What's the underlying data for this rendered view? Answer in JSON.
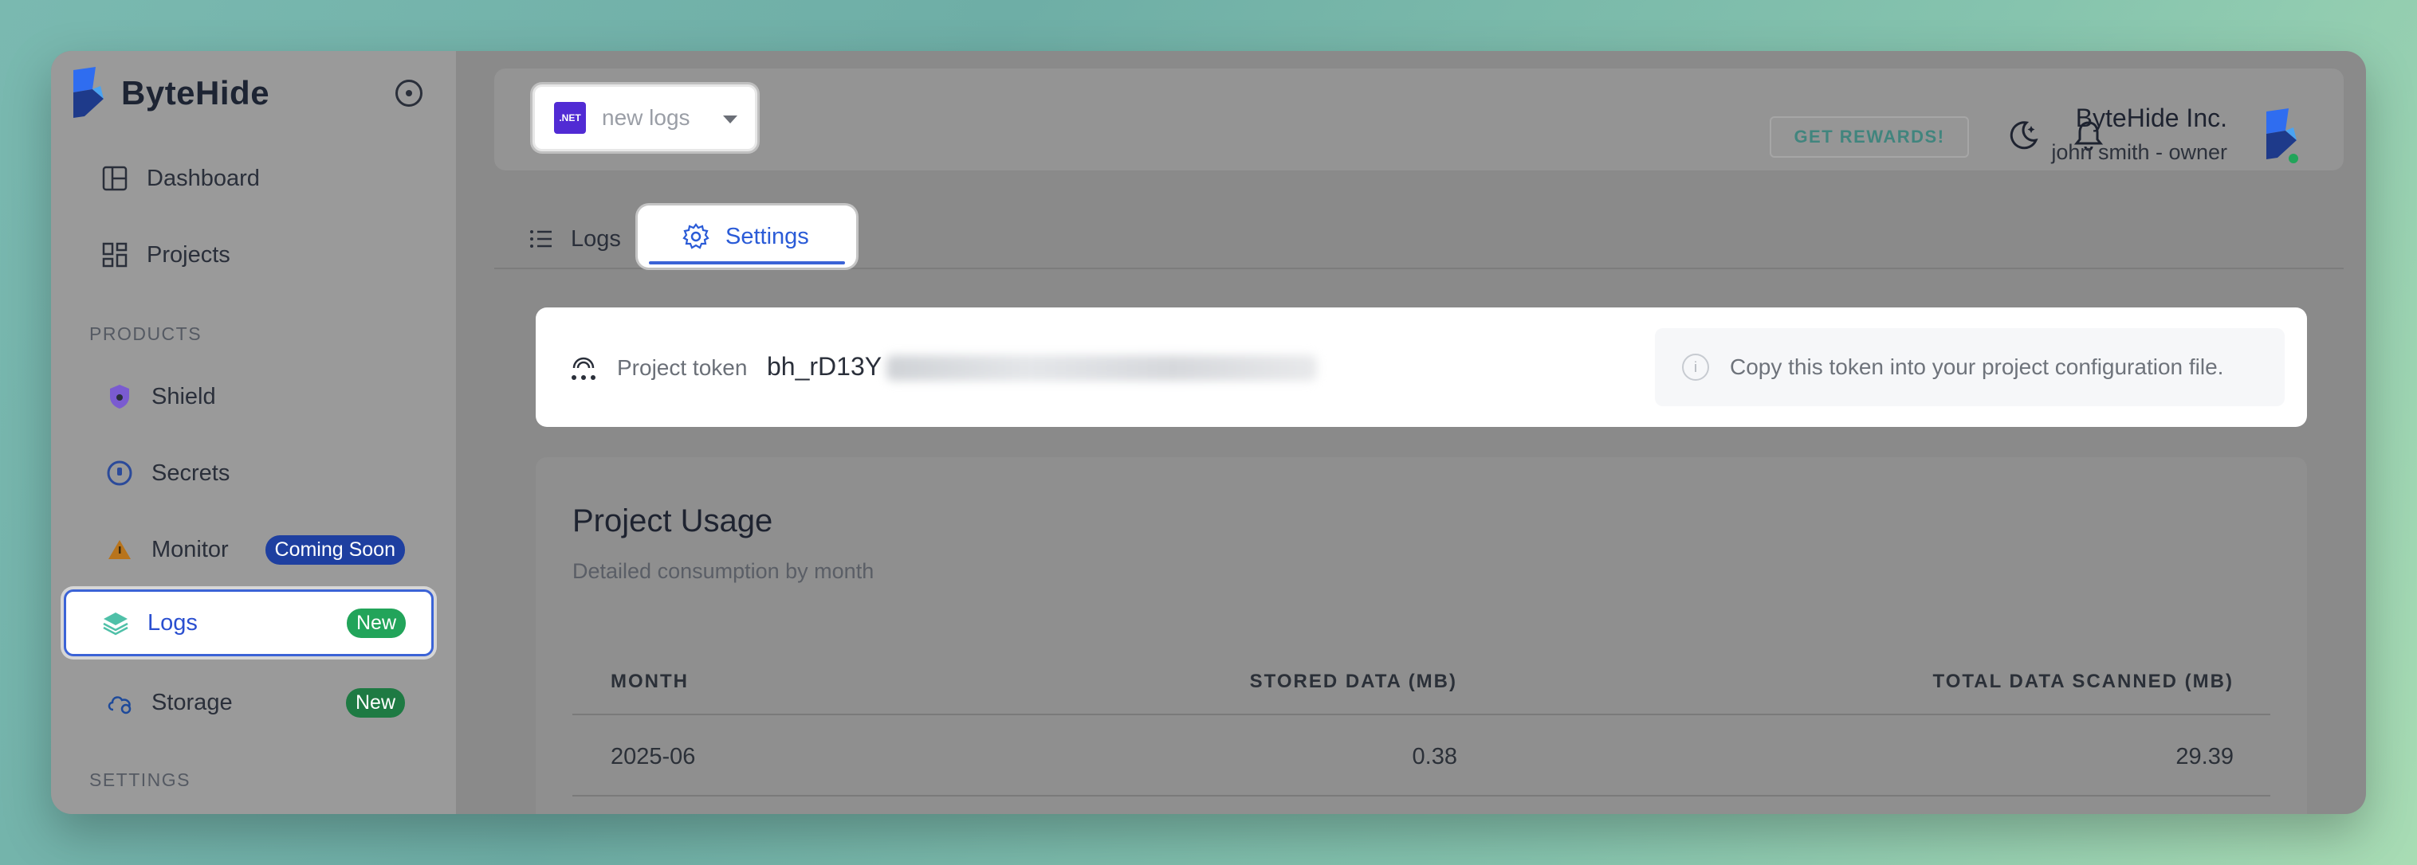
{
  "brand": {
    "name": "ByteHide"
  },
  "sidebar": {
    "items": [
      {
        "label": "Dashboard"
      },
      {
        "label": "Projects"
      }
    ],
    "section_products": "PRODUCTS",
    "products": [
      {
        "label": "Shield"
      },
      {
        "label": "Secrets"
      },
      {
        "label": "Monitor",
        "badge": "Coming Soon"
      },
      {
        "label": "Logs",
        "badge": "New"
      },
      {
        "label": "Storage",
        "badge": "New"
      }
    ],
    "section_settings": "SETTINGS"
  },
  "topbar": {
    "project_select": {
      "icon_text": ".NET",
      "value": "new logs"
    },
    "rewards_label": "GET REWARDS!",
    "user": {
      "company": "ByteHide Inc.",
      "role": "john smith - owner"
    }
  },
  "tabs": [
    {
      "label": "Logs"
    },
    {
      "label": "Settings",
      "active": true
    }
  ],
  "token": {
    "label": "Project token",
    "value_prefix": "bh_rD13Y",
    "hint": "Copy this token into your project configuration file."
  },
  "usage": {
    "title": "Project Usage",
    "subtitle": "Detailed consumption by month",
    "columns": [
      "MONTH",
      "STORED DATA (MB)",
      "TOTAL DATA SCANNED (MB)"
    ],
    "rows": [
      {
        "month": "2025-06",
        "stored": "0.38",
        "total": "29.39"
      }
    ]
  },
  "colors": {
    "accent": "#3b63d6",
    "new_badge": "#22a45a",
    "coming_soon_badge": "#1e3fa0",
    "net_purple": "#512bd4"
  }
}
